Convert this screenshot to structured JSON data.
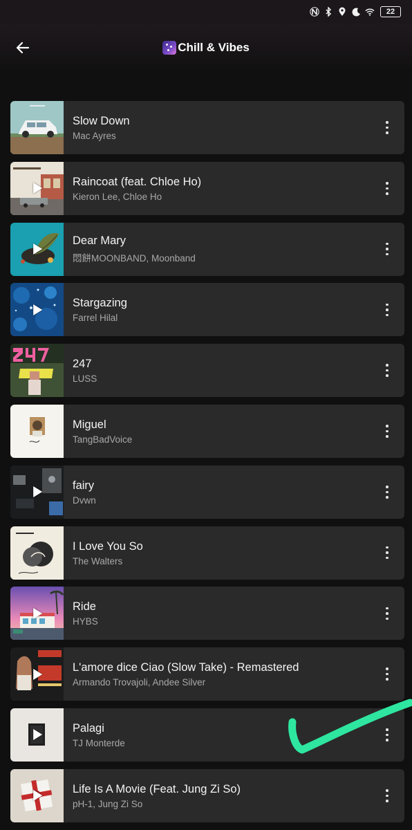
{
  "status_bar": {
    "icons": [
      "nfc-icon",
      "bluetooth-icon",
      "location-icon",
      "moon-icon",
      "wifi-icon"
    ],
    "battery": "22"
  },
  "header": {
    "back_icon": "arrow-left-icon",
    "title": "Chill & Vibes"
  },
  "colors": {
    "background": "#101010",
    "card": "#2a2a2a",
    "annotation": "#2ee6a0"
  },
  "tracks": [
    {
      "title": "Slow Down",
      "artist": "Mac Ayres"
    },
    {
      "title": "Raincoat (feat. Chloe Ho)",
      "artist": "Kieron Lee, Chloe Ho"
    },
    {
      "title": "Dear Mary",
      "artist": "悶餅MOONBAND, Moonband"
    },
    {
      "title": "Stargazing",
      "artist": "Farrel Hilal"
    },
    {
      "title": "247",
      "artist": "LUSS"
    },
    {
      "title": "Miguel",
      "artist": "TangBadVoice"
    },
    {
      "title": "fairy",
      "artist": "Dvwn"
    },
    {
      "title": "I Love You So",
      "artist": "The Walters"
    },
    {
      "title": "Ride",
      "artist": "HYBS"
    },
    {
      "title": "L'amore dice Ciao (Slow Take) - Remastered",
      "artist": "Armando Trovajoli, Andee Silver"
    },
    {
      "title": "Palagi",
      "artist": "TJ Monterde"
    },
    {
      "title": "Life Is A Movie (Feat. Jung Zi So)",
      "artist": "pH-1, Jung Zi So"
    }
  ]
}
